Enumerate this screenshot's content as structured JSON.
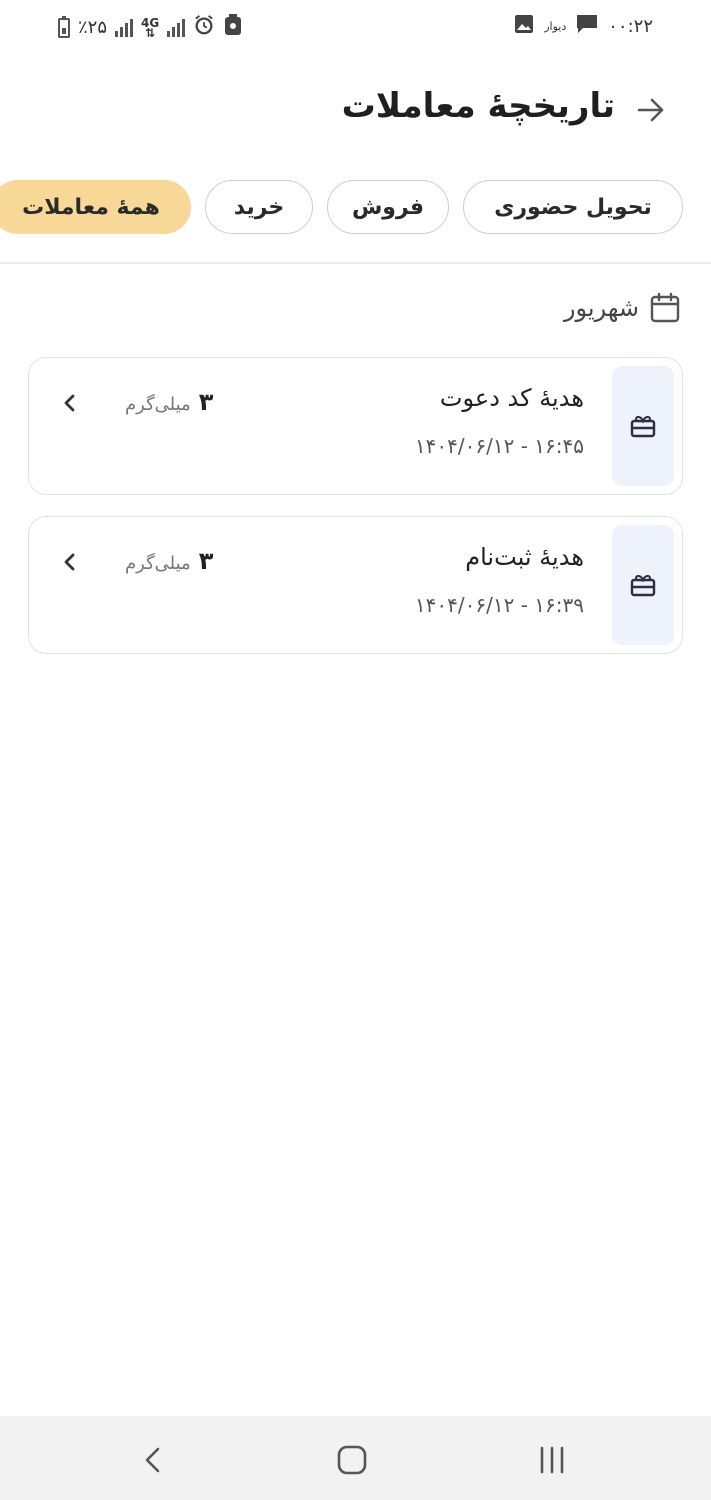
{
  "status_bar": {
    "battery_percent": "٪۲۵",
    "network_type": "4G",
    "time": "۰۰:۲۲",
    "app_notification": "دیوار",
    "icons": [
      "battery-icon",
      "signal-icon",
      "4g-icon",
      "alarm-icon",
      "recycle-icon",
      "image-icon",
      "message-icon"
    ]
  },
  "header": {
    "title": "تاریخچهٔ معاملات",
    "back_icon": "arrow-right-icon"
  },
  "tabs": [
    {
      "label": "همهٔ معاملات",
      "active": true
    },
    {
      "label": "خرید",
      "active": false
    },
    {
      "label": "فروش",
      "active": false
    },
    {
      "label": "تحویل حضوری",
      "active": false
    }
  ],
  "month": {
    "label": "شهریور",
    "icon": "calendar-icon"
  },
  "transactions": [
    {
      "title": "هدیهٔ کد دعوت",
      "datetime": "۱۶:۴۵ - ۱۴۰۴/۰۶/۱۲",
      "amount": "۳",
      "unit": "میلی‌گرم",
      "icon": "gift-icon"
    },
    {
      "title": "هدیهٔ ثبت‌نام",
      "datetime": "۱۶:۳۹ - ۱۴۰۴/۰۶/۱۲",
      "amount": "۳",
      "unit": "میلی‌گرم",
      "icon": "gift-icon"
    }
  ],
  "colors": {
    "active_tab": "#f8d896",
    "icon_box": "#eef2fa",
    "nav_bar": "#f2f2f2"
  }
}
